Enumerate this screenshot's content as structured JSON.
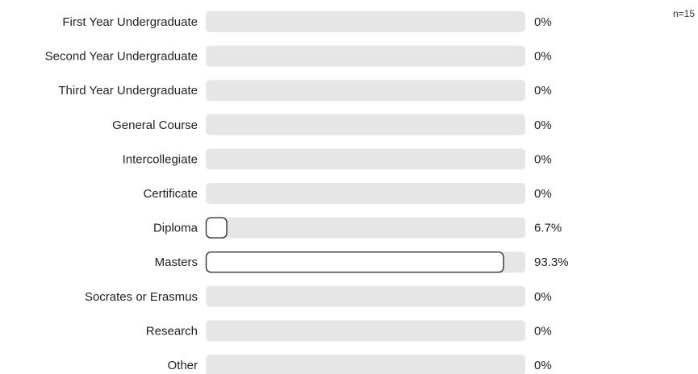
{
  "sample_size": "n=15",
  "colors": {
    "track": "#e6e6e6",
    "bar_fill": "#ffffff",
    "bar_stroke": "#333333",
    "text": "#222222"
  },
  "chart_data": {
    "type": "bar",
    "orientation": "horizontal",
    "categories": [
      "First Year Undergraduate",
      "Second Year Undergraduate",
      "Third Year Undergraduate",
      "General Course",
      "Intercollegiate",
      "Certificate",
      "Diploma",
      "Masters",
      "Socrates or Erasmus",
      "Research",
      "Other"
    ],
    "values": [
      0,
      0,
      0,
      0,
      0,
      0,
      6.7,
      93.3,
      0,
      0,
      0
    ],
    "value_labels": [
      "0%",
      "0%",
      "0%",
      "0%",
      "0%",
      "0%",
      "6.7%",
      "93.3%",
      "0%",
      "0%",
      "0%"
    ],
    "xlim": [
      0,
      100
    ],
    "unit": "%"
  }
}
